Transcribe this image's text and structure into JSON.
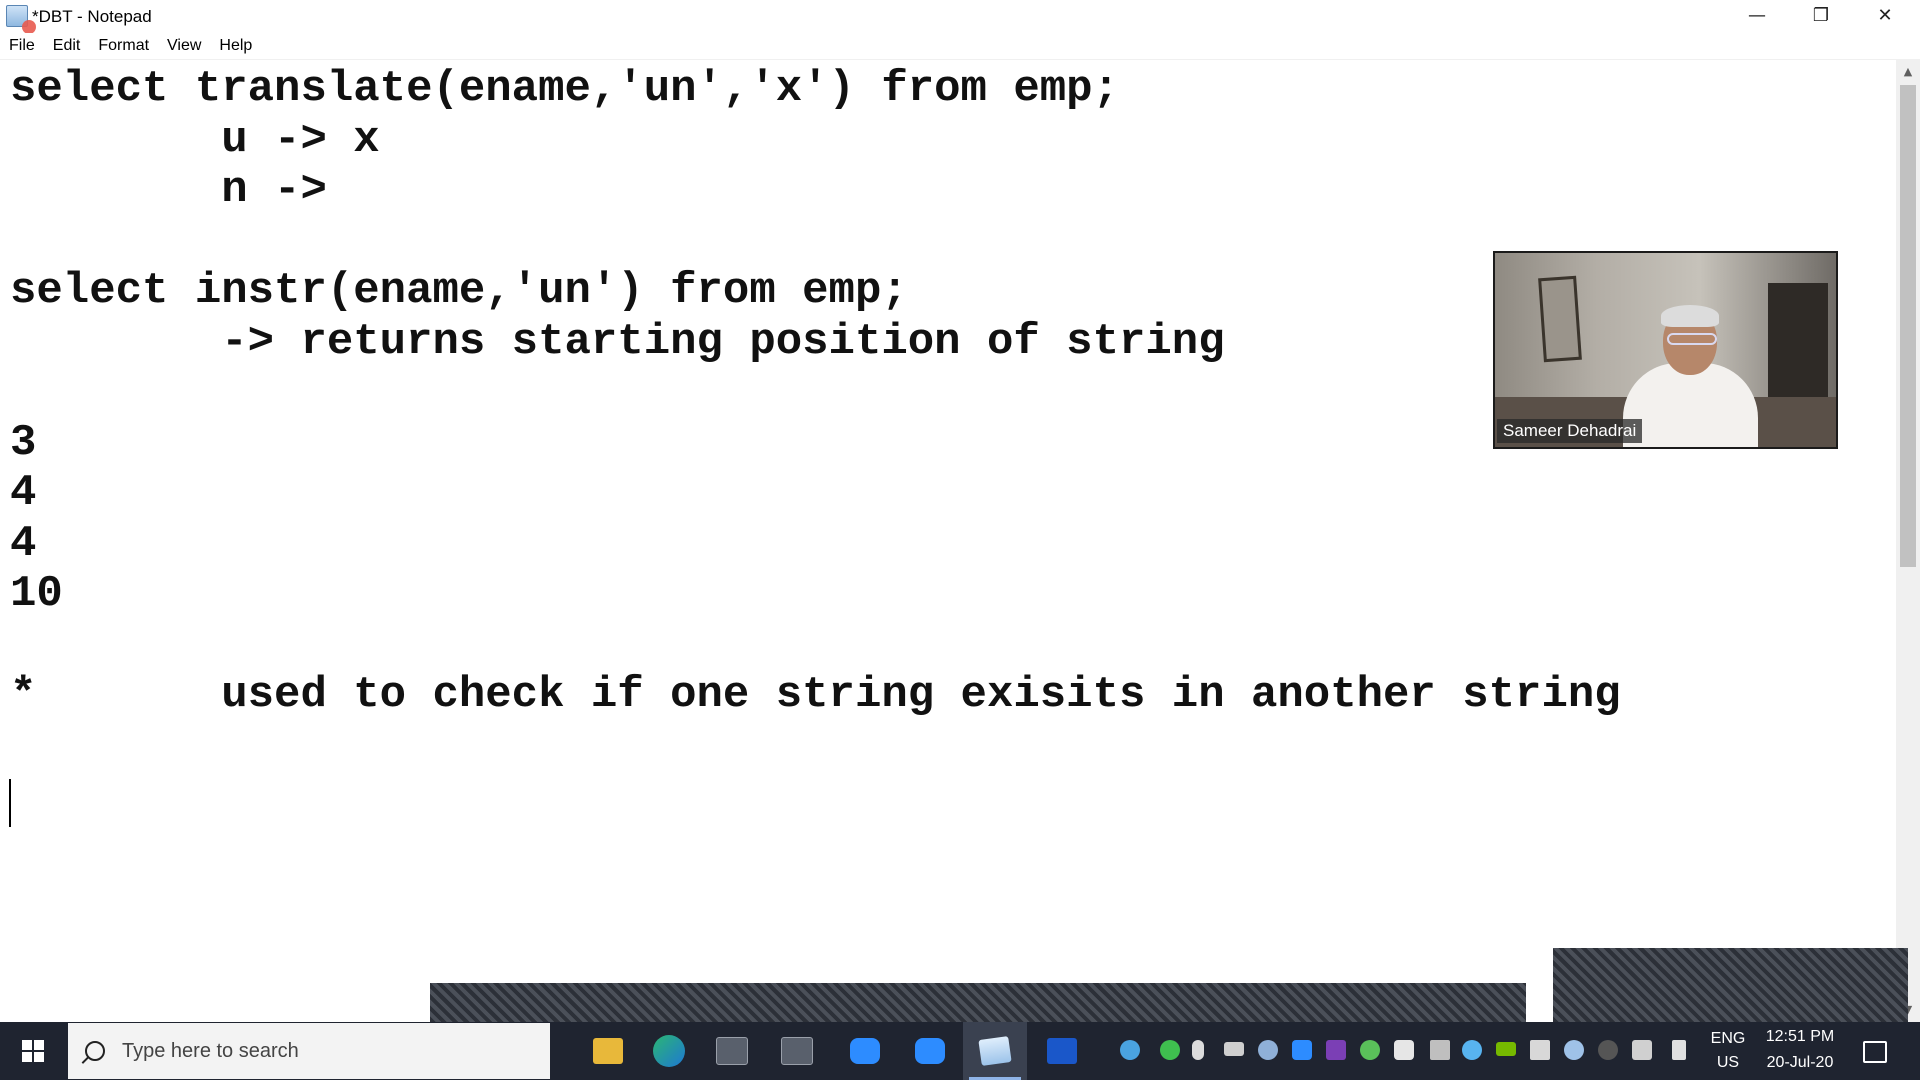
{
  "window": {
    "title": "*DBT - Notepad",
    "minimize_glyph": "—",
    "restore_glyph": "❐",
    "close_glyph": "✕"
  },
  "menu": {
    "items": [
      "File",
      "Edit",
      "Format",
      "View",
      "Help"
    ]
  },
  "editor": {
    "lines": [
      "select translate(ename,'un','x') from emp;",
      "        u -> x",
      "        n ->",
      "",
      "select instr(ename,'un') from emp;",
      "        -> returns starting position of string",
      "",
      "3",
      "4",
      "4",
      "10",
      "",
      "*       used to check if one string exisits in another string"
    ]
  },
  "video": {
    "participant_name": "Sameer Dehadrai"
  },
  "taskbar": {
    "search_placeholder": "Type here to search",
    "apps": [
      "file-explorer",
      "edge",
      "sql-window-1",
      "sql-window-2",
      "zoom-1",
      "zoom-2",
      "notepad",
      "whiteboard"
    ],
    "language_top": "ENG",
    "language_bottom": "US",
    "time": "12:51 PM",
    "date": "20-Jul-20"
  },
  "colors": {
    "taskbar_bg": "#1f2430",
    "accent": "#8fb4e8"
  }
}
